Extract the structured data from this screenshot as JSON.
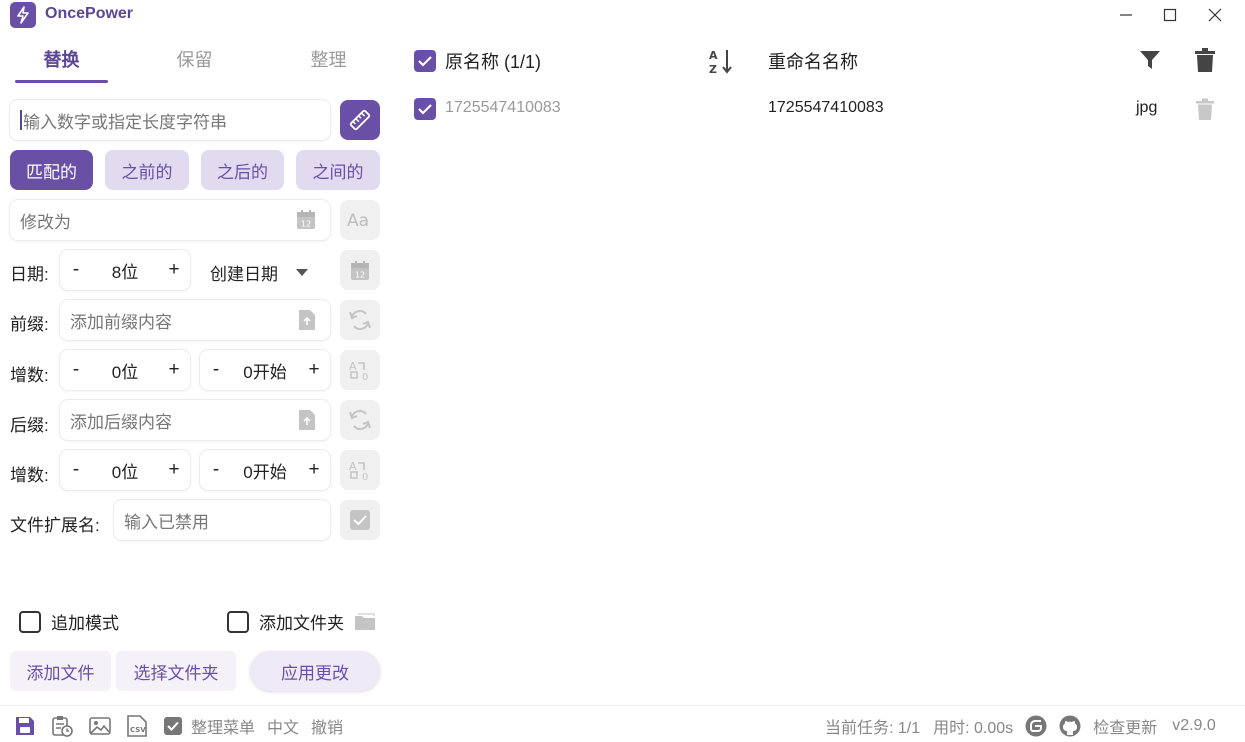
{
  "app": {
    "title": "OncePower",
    "version": "v2.9.0",
    "accent": "#6a4fa6"
  },
  "tabs": [
    "替换",
    "保留",
    "整理"
  ],
  "search": {
    "placeholder": "输入数字或指定长度字符串"
  },
  "match_modes": [
    "匹配的",
    "之前的",
    "之后的",
    "之间的"
  ],
  "modify": {
    "placeholder": "修改为"
  },
  "date": {
    "label": "日期:",
    "minus": "-",
    "value": "8位",
    "plus": "+",
    "type": "创建日期"
  },
  "prefix": {
    "label": "前缀:",
    "placeholder": "添加前缀内容"
  },
  "prefix_increment": {
    "label": "增数:",
    "digits": "0位",
    "start": "0开始",
    "minus": "-",
    "plus": "+"
  },
  "suffix": {
    "label": "后缀:",
    "placeholder": "添加后缀内容"
  },
  "suffix_increment": {
    "label": "增数:",
    "digits": "0位",
    "start": "0开始",
    "minus": "-",
    "plus": "+"
  },
  "extension": {
    "label": "文件扩展名:",
    "placeholder": "输入已禁用"
  },
  "options": {
    "append_mode": "追加模式",
    "add_folder": "添加文件夹"
  },
  "actions": {
    "add_files": "添加文件",
    "select_folder": "选择文件夹",
    "apply": "应用更改"
  },
  "statusbar": {
    "organize_menu": "整理菜单",
    "language": "中文",
    "undo": "撤销",
    "current_task": "当前任务: 1/1",
    "elapsed": "用时: 0.00s",
    "check_update": "检查更新",
    "version": "v2.9.0"
  },
  "list": {
    "header_original": "原名称 (1/1)",
    "header_renamed": "重命名名称",
    "rows": [
      {
        "original": "1725547410083",
        "renamed": "1725547410083",
        "ext": "jpg",
        "checked": true
      }
    ]
  }
}
